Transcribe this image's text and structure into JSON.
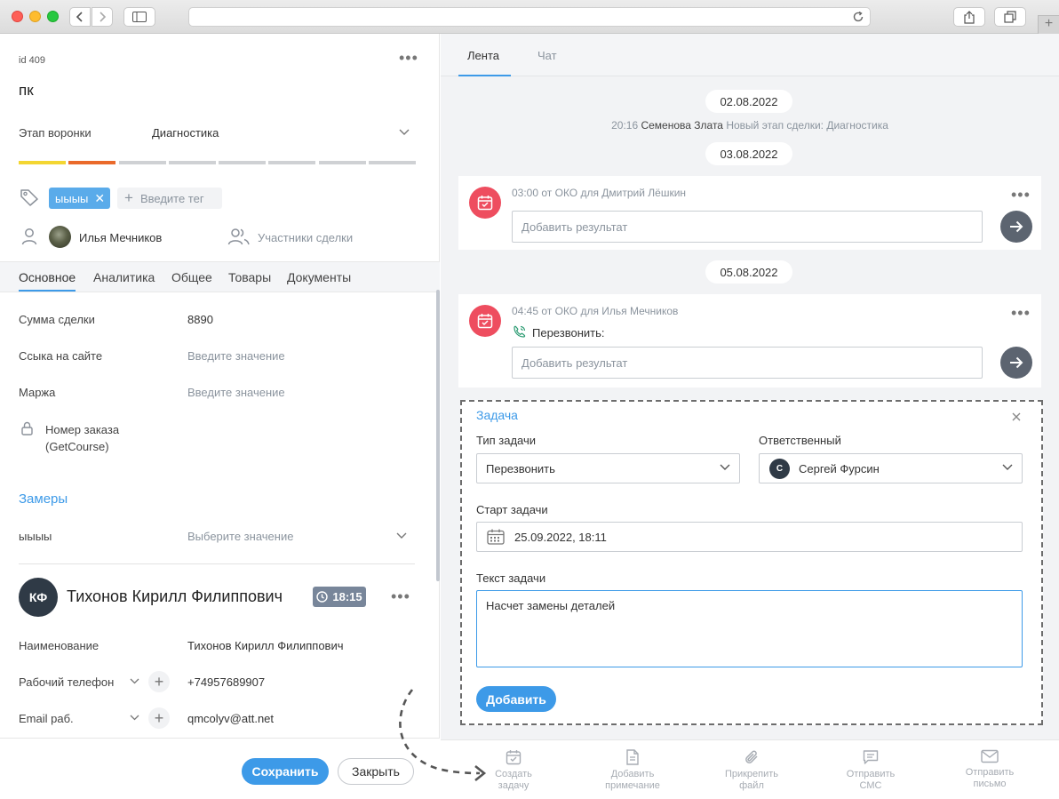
{
  "left": {
    "deal_id": "id 409",
    "deal_title": "пк",
    "stage_label": "Этап воронки",
    "stage_value": "Диагностика",
    "stage_colors": [
      "#f3d632",
      "#ea6a2b",
      "#cfd1d4",
      "#cfd1d4",
      "#cfd1d4",
      "#cfd1d4",
      "#cfd1d4",
      "#cfd1d4"
    ],
    "tag": "ыыыы",
    "tag_placeholder": "Введите тег",
    "responsible": "Илья Мечников",
    "participants": "Участники сделки",
    "tabs": [
      "Основное",
      "Аналитика",
      "Общее",
      "Товары",
      "Документы"
    ],
    "fields": {
      "sum_label": "Сумма сделки",
      "sum_value": "8890",
      "link_label": "Ссыка на сайте",
      "link_placeholder": "Введите значение",
      "margin_label": "Маржа",
      "margin_placeholder": "Введите значение",
      "order_label_1": "Номер заказа",
      "order_label_2": "(GetCourse)"
    },
    "measurements": {
      "title": "Замеры",
      "field_label": "ыыыы",
      "field_placeholder": "Выберите значение"
    },
    "contact": {
      "initials": "КФ",
      "name": "Тихонов Кирилл Филиппович",
      "time": "18:15",
      "name_label": "Наименование",
      "name_value": "Тихонов Кирилл Филиппович",
      "phone_label": "Рабочий телефон",
      "phone_value": "+74957689907",
      "email_label": "Email раб.",
      "email_value": "qmcolyv@att.net"
    },
    "save_label": "Сохранить",
    "close_label": "Закрыть"
  },
  "right": {
    "tabs": [
      "Лента",
      "Чат"
    ],
    "date1": "02.08.2022",
    "event": {
      "time": "20:16",
      "author": "Семенова Злата",
      "text": "Новый этап сделки: Диагностика"
    },
    "date2": "03.08.2022",
    "task1": {
      "meta": "03:00 от ОКО для Дмитрий Лёшкин",
      "placeholder": "Добавить результат"
    },
    "date3": "05.08.2022",
    "task2": {
      "meta": "04:45 от ОКО для Илья Мечников",
      "call_label": "Перезвонить:",
      "placeholder": "Добавить результат"
    },
    "form": {
      "title": "Задача",
      "type_label": "Тип задачи",
      "type_value": "Перезвонить",
      "resp_label": "Ответственный",
      "resp_initial": "С",
      "resp_value": "Сергей Фурсин",
      "start_label": "Старт задачи",
      "start_value": "25.09.2022, 18:11",
      "text_label": "Текст задачи",
      "text_value": "Насчет замены деталей",
      "add_label": "Добавить"
    },
    "actions": [
      {
        "line1": "Создать",
        "line2": "задачу",
        "icon": "calendar-icon"
      },
      {
        "line1": "Добавить",
        "line2": "примечание",
        "icon": "document-icon"
      },
      {
        "line1": "Прикрепить",
        "line2": "файл",
        "icon": "paperclip-icon"
      },
      {
        "line1": "Отправить",
        "line2": "СМС",
        "icon": "message-icon"
      },
      {
        "line1": "Отправить",
        "line2": "письмо",
        "icon": "envelope-icon"
      }
    ]
  }
}
